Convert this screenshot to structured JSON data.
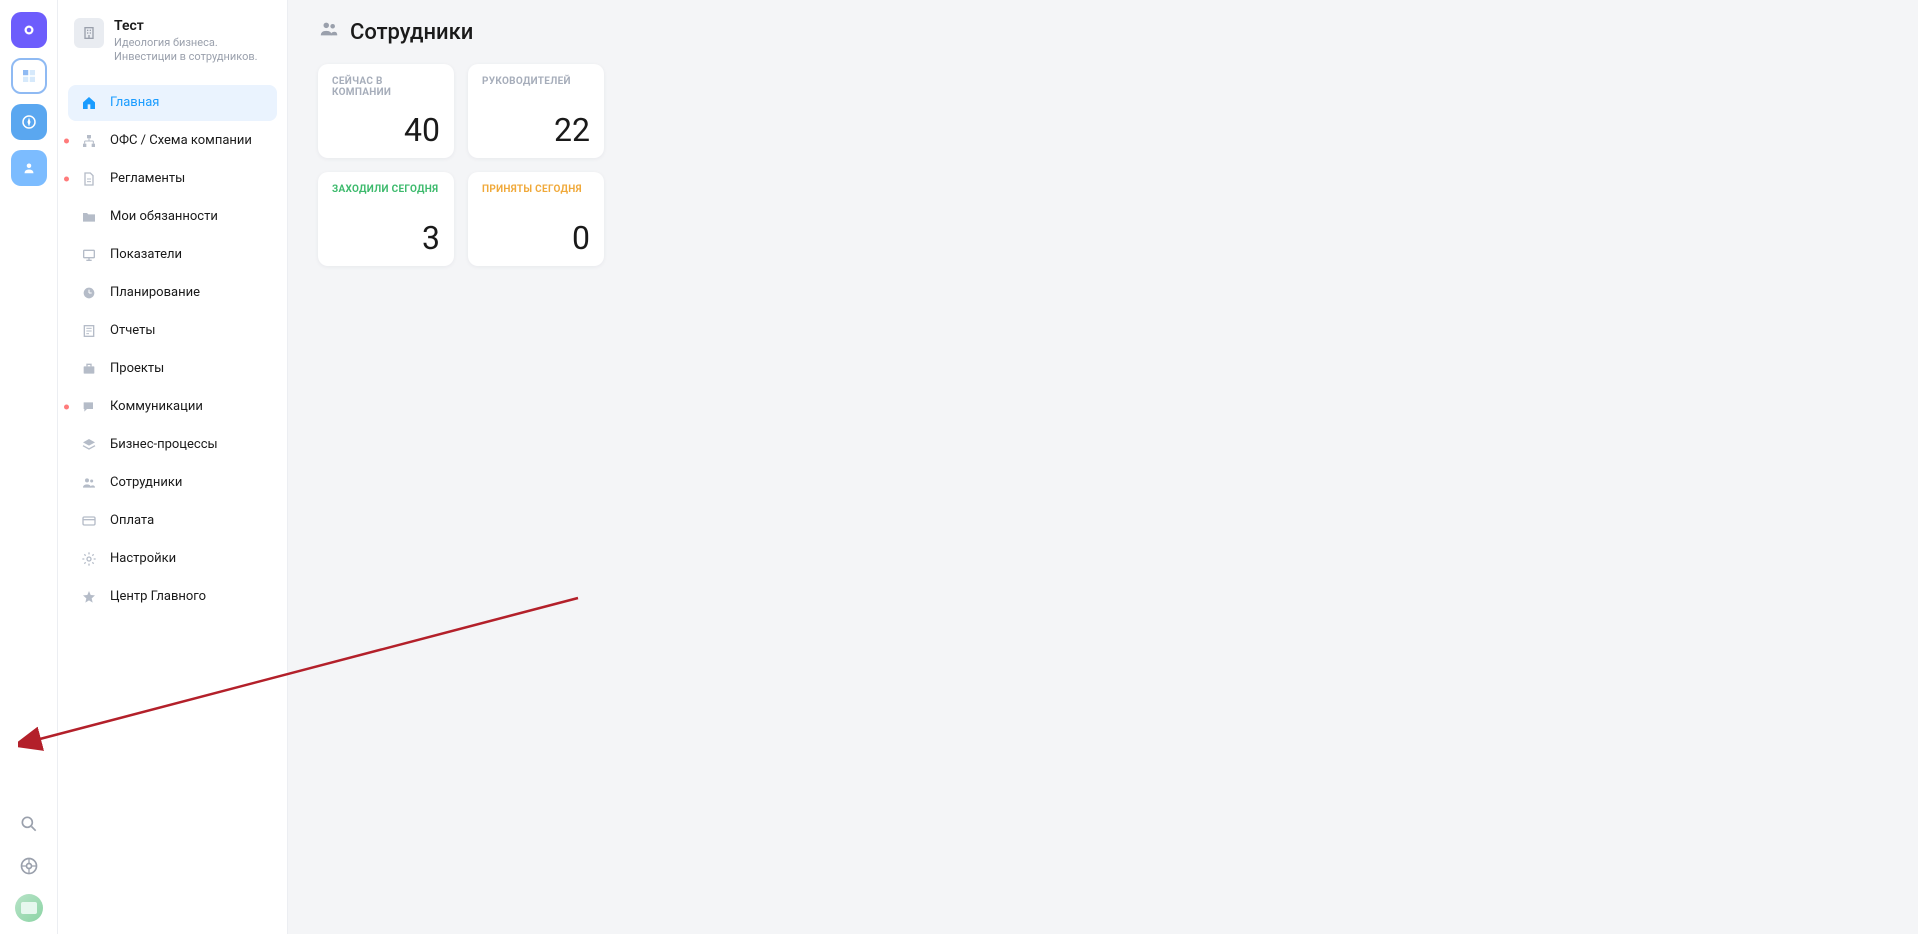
{
  "rail": {
    "icons": [
      "logo",
      "app-selected",
      "compass",
      "user"
    ]
  },
  "org": {
    "title": "Тест",
    "subtitle": "Идеология бизнеса. Инвестиции в сотрудников."
  },
  "nav": {
    "items": [
      {
        "label": "Главная",
        "icon": "home",
        "active": true,
        "dot": false
      },
      {
        "label": "ОФС / Схема компании",
        "icon": "org-chart",
        "active": false,
        "dot": true
      },
      {
        "label": "Регламенты",
        "icon": "document",
        "active": false,
        "dot": true
      },
      {
        "label": "Мои обязанности",
        "icon": "folder",
        "active": false,
        "dot": false
      },
      {
        "label": "Показатели",
        "icon": "presentation",
        "active": false,
        "dot": false
      },
      {
        "label": "Планирование",
        "icon": "clock",
        "active": false,
        "dot": false
      },
      {
        "label": "Отчеты",
        "icon": "report",
        "active": false,
        "dot": false
      },
      {
        "label": "Проекты",
        "icon": "briefcase",
        "active": false,
        "dot": false
      },
      {
        "label": "Коммуникации",
        "icon": "chat",
        "active": false,
        "dot": true
      },
      {
        "label": "Бизнес-процессы",
        "icon": "layers",
        "active": false,
        "dot": false
      },
      {
        "label": "Сотрудники",
        "icon": "people",
        "active": false,
        "dot": false
      },
      {
        "label": "Оплата",
        "icon": "card",
        "active": false,
        "dot": false
      },
      {
        "label": "Настройки",
        "icon": "gear",
        "active": false,
        "dot": false
      },
      {
        "label": "Центр Главного",
        "icon": "star",
        "active": false,
        "dot": false
      }
    ]
  },
  "page": {
    "title": "Сотрудники"
  },
  "stats": {
    "cards": [
      {
        "label": "СЕЙЧАС В КОМПАНИИ",
        "value": "40",
        "labelClass": "gray"
      },
      {
        "label": "РУКОВОДИТЕЛЕЙ",
        "value": "22",
        "labelClass": "gray"
      },
      {
        "label": "ЗАХОДИЛИ СЕГОДНЯ",
        "value": "3",
        "labelClass": "green"
      },
      {
        "label": "ПРИНЯТЫ СЕГОДНЯ",
        "value": "0",
        "labelClass": "orange"
      }
    ]
  },
  "annotation": {
    "arrow_color": "#b3202a"
  }
}
